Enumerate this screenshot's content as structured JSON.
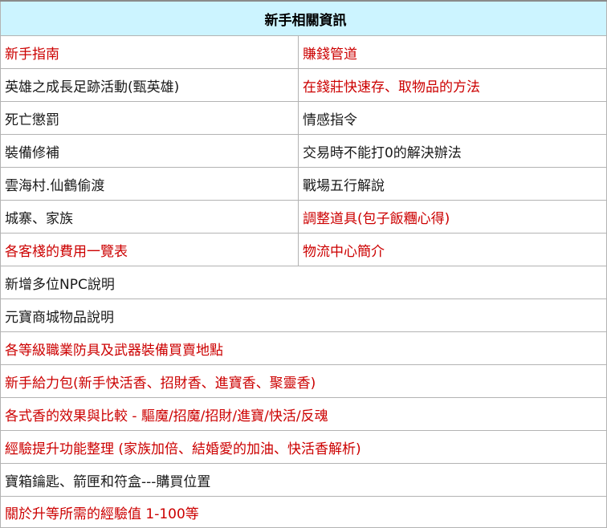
{
  "title": "新手相關資訊",
  "colors": {
    "header_bg": "#ccf4ff",
    "red_link": "#cc0000",
    "dark_link": "#1a1a1a",
    "border": "#b3b3b3"
  },
  "rows": [
    {
      "left": {
        "text": "新手指南",
        "style": "red"
      },
      "right": {
        "text": "賺錢管道",
        "style": "red"
      }
    },
    {
      "left": {
        "text": "英雄之成長足跡活動(甄英雄)",
        "style": "dark"
      },
      "right": {
        "text": "在錢莊快速存、取物品的方法",
        "style": "red"
      }
    },
    {
      "left": {
        "text": "死亡懲罰",
        "style": "dark"
      },
      "right": {
        "text": "情感指令",
        "style": "dark"
      }
    },
    {
      "left": {
        "text": "裝備修補",
        "style": "dark"
      },
      "right": {
        "text": "交易時不能打0的解決辦法",
        "style": "dark"
      }
    },
    {
      "left": {
        "text": "雲海村.仙鶴偷渡",
        "style": "dark"
      },
      "right": {
        "text": "戰場五行解說",
        "style": "dark"
      }
    },
    {
      "left": {
        "text": "城寨、家族",
        "style": "dark"
      },
      "right": {
        "text": "調整道具(包子飯糰心得)",
        "style": "red"
      }
    },
    {
      "left": {
        "text": "各客棧的費用一覽表",
        "style": "red"
      },
      "right": {
        "text": "物流中心簡介",
        "style": "red"
      }
    }
  ],
  "full_rows": [
    {
      "text": "新增多位NPC說明",
      "style": "dark"
    },
    {
      "text": "元寶商城物品說明",
      "style": "dark"
    },
    {
      "text": "各等級職業防具及武器裝備買賣地點",
      "style": "red"
    },
    {
      "text": "新手給力包(新手快活香、招財香、進寶香、聚靈香)",
      "style": "red"
    },
    {
      "text": "各式香的效果與比較 - 驅魔/招魔/招財/進寶/快活/反魂",
      "style": "red"
    },
    {
      "text": "經驗提升功能整理 (家族加倍、結婚愛的加油、快活香解析)",
      "style": "red"
    },
    {
      "text": "寶箱鑰匙、箭匣和符盒---購買位置",
      "style": "dark"
    },
    {
      "text": "關於升等所需的經驗值 1-100等",
      "style": "red"
    }
  ]
}
